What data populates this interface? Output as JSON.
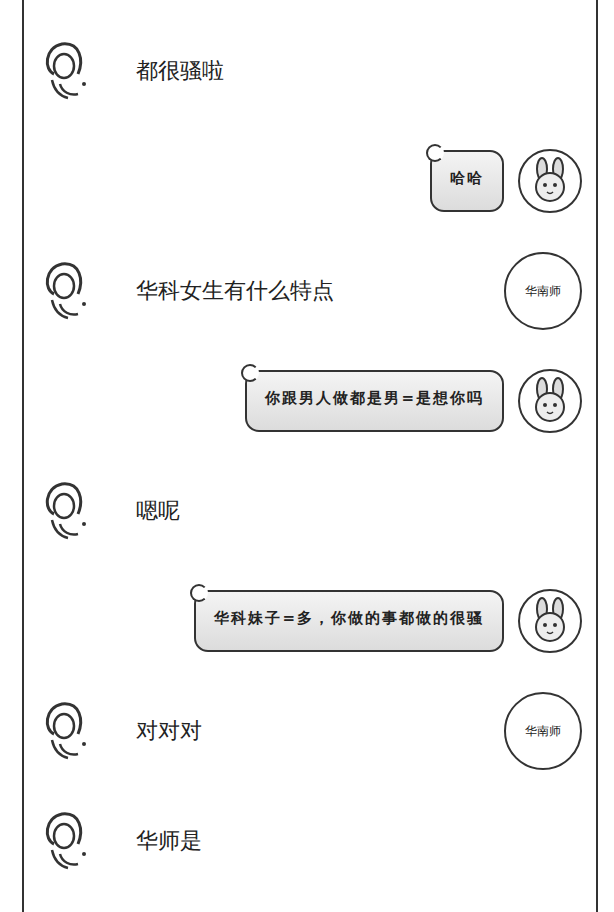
{
  "messages": [
    {
      "kind": "received",
      "text": "都很骚啦",
      "badge": ""
    },
    {
      "kind": "sent",
      "text": "哈哈",
      "badge": ""
    },
    {
      "kind": "received",
      "text": "华科女生有什么特点",
      "badge": "华南师"
    },
    {
      "kind": "sent",
      "text": "你跟男人做都是男=是想你吗",
      "badge": ""
    },
    {
      "kind": "received",
      "text": "嗯呢",
      "badge": ""
    },
    {
      "kind": "sent",
      "text": "华科妹子=多，你做的事都做的很骚",
      "badge": ""
    },
    {
      "kind": "received",
      "text": "对对对",
      "badge": "华南师"
    },
    {
      "kind": "received",
      "text": "华师是",
      "badge": ""
    }
  ]
}
